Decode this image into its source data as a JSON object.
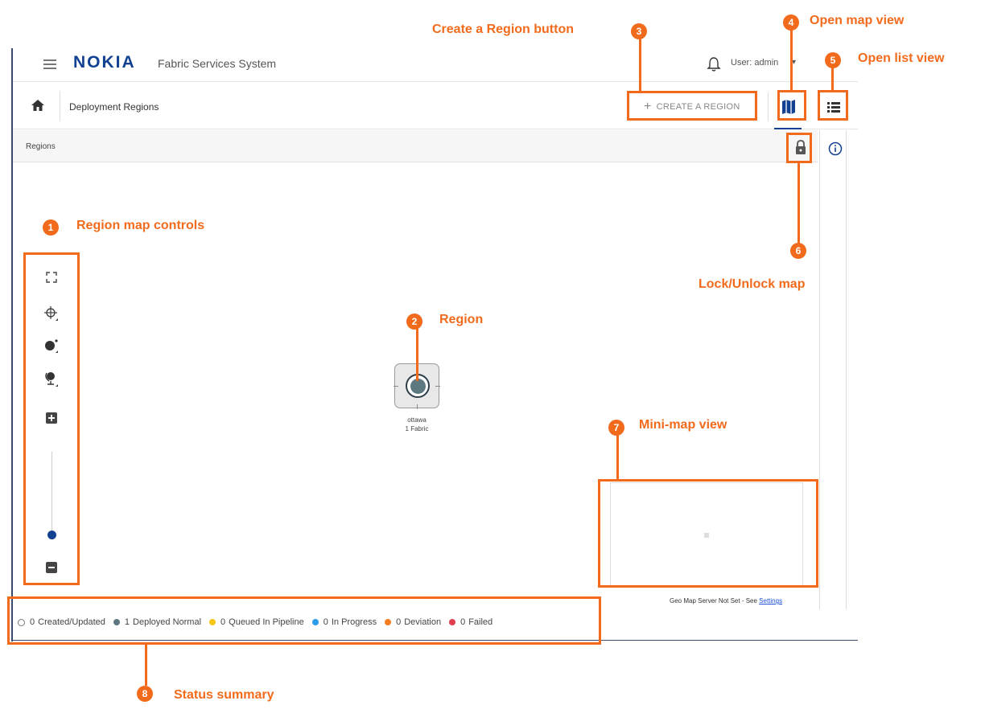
{
  "topbar": {
    "logo": "NOKIA",
    "app_title": "Fabric Services System",
    "user": "User: admin"
  },
  "subbar": {
    "page_title": "Deployment Regions",
    "create_button": "CREATE A REGION"
  },
  "regions_bar": {
    "label": "Regions"
  },
  "map_controls": {
    "icons": [
      "fit-screen-icon",
      "center-node-icon",
      "layout-icon",
      "geo-layout-icon",
      "zoom-in-icon",
      "zoom-out-icon"
    ]
  },
  "region": {
    "name": "ottawa",
    "subtitle": "1 Fabric"
  },
  "minimap": {
    "note_prefix": "Geo Map Server Not Set - See ",
    "note_link": "Settings"
  },
  "status_summary": [
    {
      "count": "0",
      "label": "Created/Updated",
      "color": "#ffffff"
    },
    {
      "count": "1",
      "label": "Deployed Normal",
      "color": "#5d7880"
    },
    {
      "count": "0",
      "label": "Queued In Pipeline",
      "color": "#f5c518"
    },
    {
      "count": "0",
      "label": "In Progress",
      "color": "#2c9be8"
    },
    {
      "count": "0",
      "label": "Deviation",
      "color": "#f57c1f"
    },
    {
      "count": "0",
      "label": "Failed",
      "color": "#e23d4d"
    }
  ],
  "annotations": [
    {
      "num": "1",
      "text": "Region map controls"
    },
    {
      "num": "2",
      "text": "Region"
    },
    {
      "num": "3",
      "text": "Create a Region button"
    },
    {
      "num": "4",
      "text": "Open map view"
    },
    {
      "num": "5",
      "text": "Open list view"
    },
    {
      "num": "6",
      "text": "Lock/Unlock map"
    },
    {
      "num": "7",
      "text": "Mini-map view"
    },
    {
      "num": "8",
      "text": "Status summary"
    }
  ],
  "colors": {
    "accent": "#f26b1d",
    "brand": "#124191"
  }
}
